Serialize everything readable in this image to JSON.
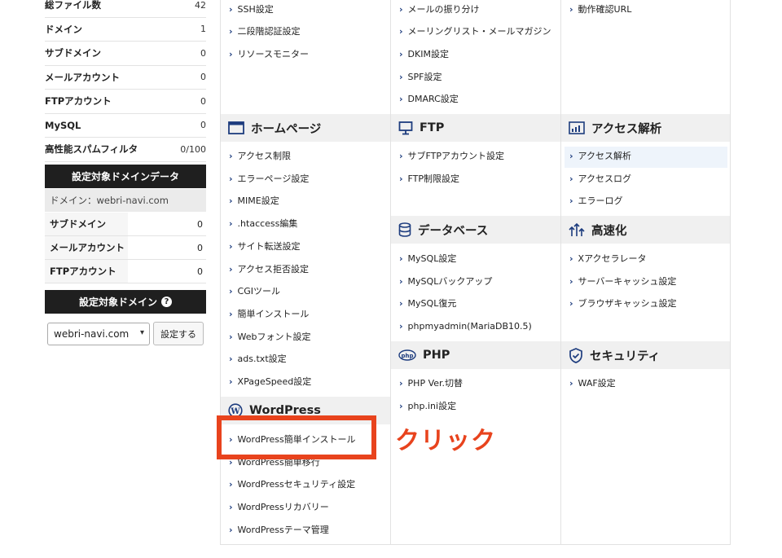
{
  "sidebar": {
    "stats": [
      {
        "label": "総ファイル数",
        "value": "42"
      },
      {
        "label": "ドメイン",
        "value": "1"
      },
      {
        "label": "サブドメイン",
        "value": "0"
      },
      {
        "label": "メールアカウント",
        "value": "0"
      },
      {
        "label": "FTPアカウント",
        "value": "0"
      },
      {
        "label": "MySQL",
        "value": "0"
      },
      {
        "label": "高性能スパムフィルタ",
        "value": "0/100"
      }
    ],
    "domain_data_title": "設定対象ドメインデータ",
    "domain_info": "ドメイン：webri-navi.com",
    "domain_stats": [
      {
        "label": "サブドメイン",
        "value": "0"
      },
      {
        "label": "メールアカウント",
        "value": "0"
      },
      {
        "label": "FTPアカウント",
        "value": "0"
      }
    ],
    "target_domain_title": "設定対象ドメイン",
    "help_icon": "?",
    "domain_select_value": "webri-navi.com",
    "set_button": "設定する"
  },
  "sections": {
    "top_col1": [
      "SSH設定",
      "二段階認証設定",
      "リソースモニター"
    ],
    "top_col2": [
      "メールの振り分け",
      "メーリングリスト・メールマガジン",
      "DKIM設定",
      "SPF設定",
      "DMARC設定"
    ],
    "top_col3": [
      "動作確認URL"
    ],
    "homepage": {
      "title": "ホームページ",
      "icon": "window-icon",
      "items": [
        "アクセス制限",
        "エラーページ設定",
        "MIME設定",
        ".htaccess編集",
        "サイト転送設定",
        "アクセス拒否設定",
        "CGIツール",
        "簡単インストール",
        "Webフォント設定",
        "ads.txt設定",
        "XPageSpeed設定"
      ]
    },
    "wordpress": {
      "title": "WordPress",
      "icon": "wordpress-icon",
      "items": [
        "WordPress簡単インストール",
        "WordPress簡単移行",
        "WordPressセキュリティ設定",
        "WordPressリカバリー",
        "WordPressテーマ管理"
      ]
    },
    "ftp": {
      "title": "FTP",
      "icon": "monitor-icon",
      "items": [
        "サブFTPアカウント設定",
        "FTP制限設定"
      ]
    },
    "database": {
      "title": "データベース",
      "icon": "database-icon",
      "items": [
        "MySQL設定",
        "MySQLバックアップ",
        "MySQL復元",
        "phpmyadmin(MariaDB10.5)"
      ]
    },
    "php": {
      "title": "PHP",
      "icon": "php-icon",
      "items": [
        "PHP Ver.切替",
        "php.ini設定"
      ]
    },
    "access": {
      "title": "アクセス解析",
      "icon": "bar-chart-icon",
      "items": [
        "アクセス解析",
        "アクセスログ",
        "エラーログ"
      ]
    },
    "speed": {
      "title": "高速化",
      "icon": "speed-icon",
      "items": [
        "Xアクセラレータ",
        "サーバーキャッシュ設定",
        "ブラウザキャッシュ設定"
      ]
    },
    "security": {
      "title": "セキュリティ",
      "icon": "shield-icon",
      "items": [
        "WAF設定"
      ]
    }
  },
  "annotation": {
    "click_label": "クリック",
    "color": "#e8431d"
  },
  "colors": {
    "accent": "#1d3c7e",
    "header_bg": "#f0f0f0",
    "dark": "#1f1f1f"
  }
}
